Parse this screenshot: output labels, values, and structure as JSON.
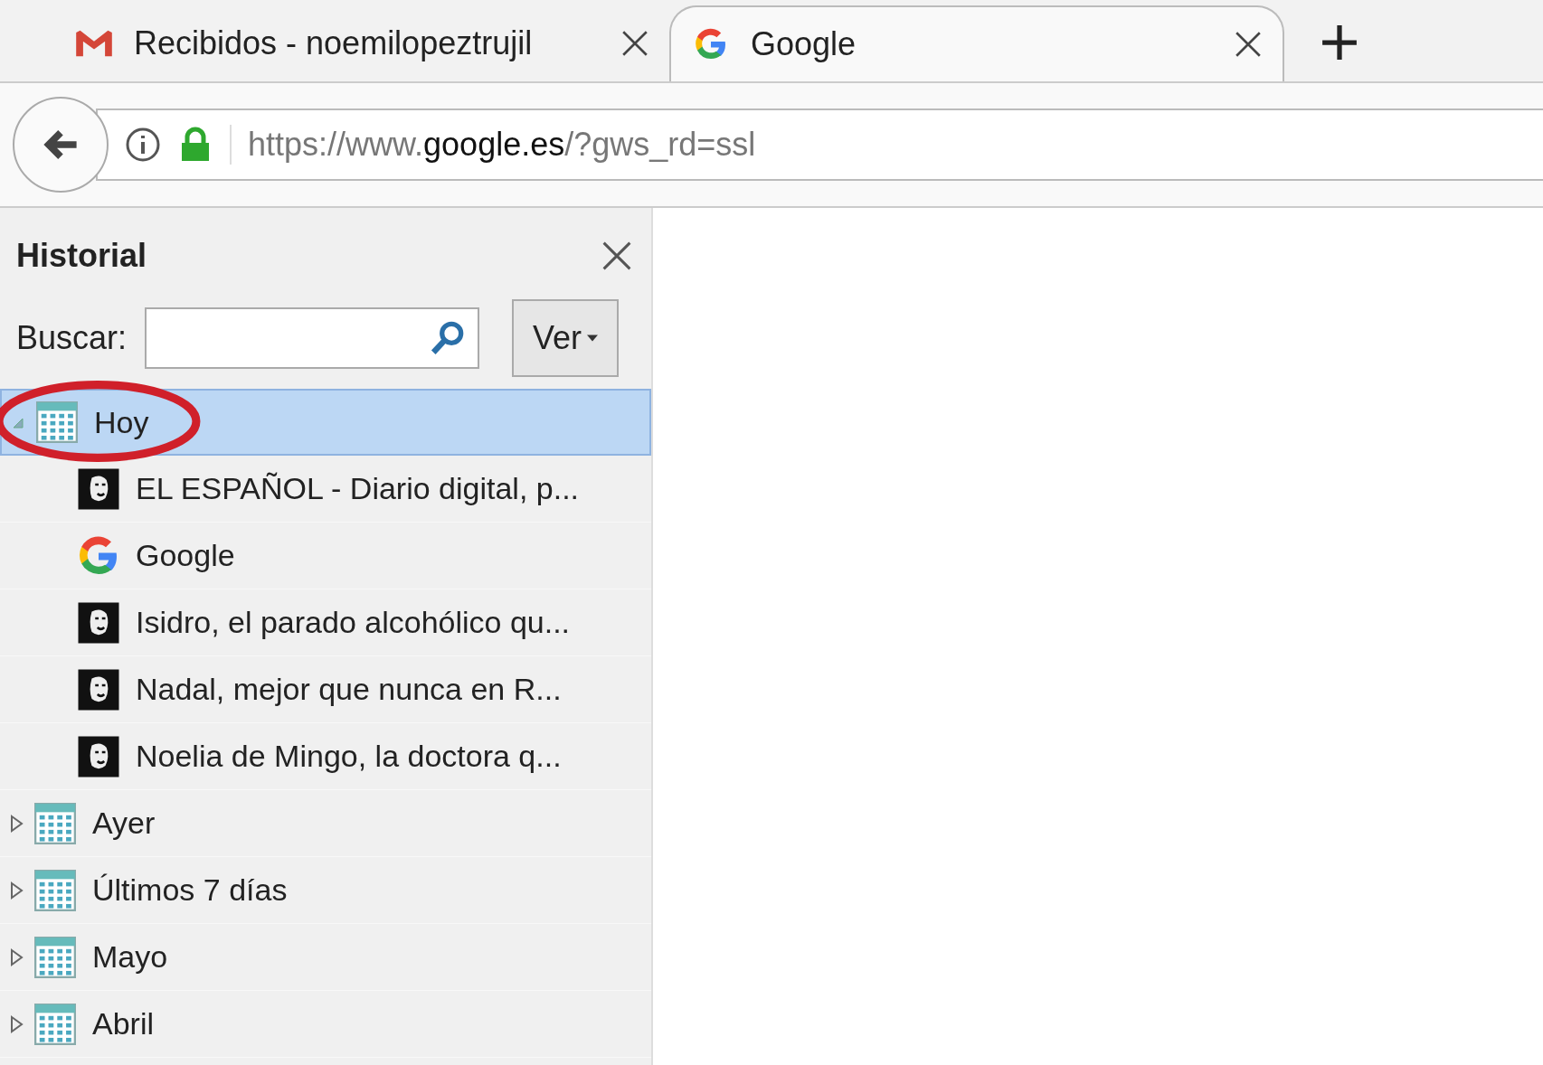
{
  "tabs": [
    {
      "title": "Recibidos - noemilopeztrujil",
      "kind": "gmail",
      "selected": false
    },
    {
      "title": "Google",
      "kind": "google",
      "selected": true
    }
  ],
  "address_bar": {
    "url_prefix": "https://www.",
    "url_domain": "google.es",
    "url_path": "/?gws_rd=ssl"
  },
  "sidebar": {
    "title": "Historial",
    "search_label": "Buscar:",
    "view_button": "Ver",
    "tree": [
      {
        "label": "Hoy",
        "expanded": true,
        "selected": true,
        "children": [
          {
            "label": "EL ESPAÑOL - Diario digital, p...",
            "kind": "lion"
          },
          {
            "label": "Google",
            "kind": "google"
          },
          {
            "label": "Isidro, el parado alcohólico qu...",
            "kind": "lion"
          },
          {
            "label": "Nadal, mejor que nunca en R...",
            "kind": "lion"
          },
          {
            "label": "Noelia de Mingo, la doctora q...",
            "kind": "lion"
          }
        ]
      },
      {
        "label": "Ayer",
        "expanded": false,
        "selected": false
      },
      {
        "label": "Últimos 7 días",
        "expanded": false,
        "selected": false
      },
      {
        "label": "Mayo",
        "expanded": false,
        "selected": false
      },
      {
        "label": "Abril",
        "expanded": false,
        "selected": false
      }
    ]
  }
}
